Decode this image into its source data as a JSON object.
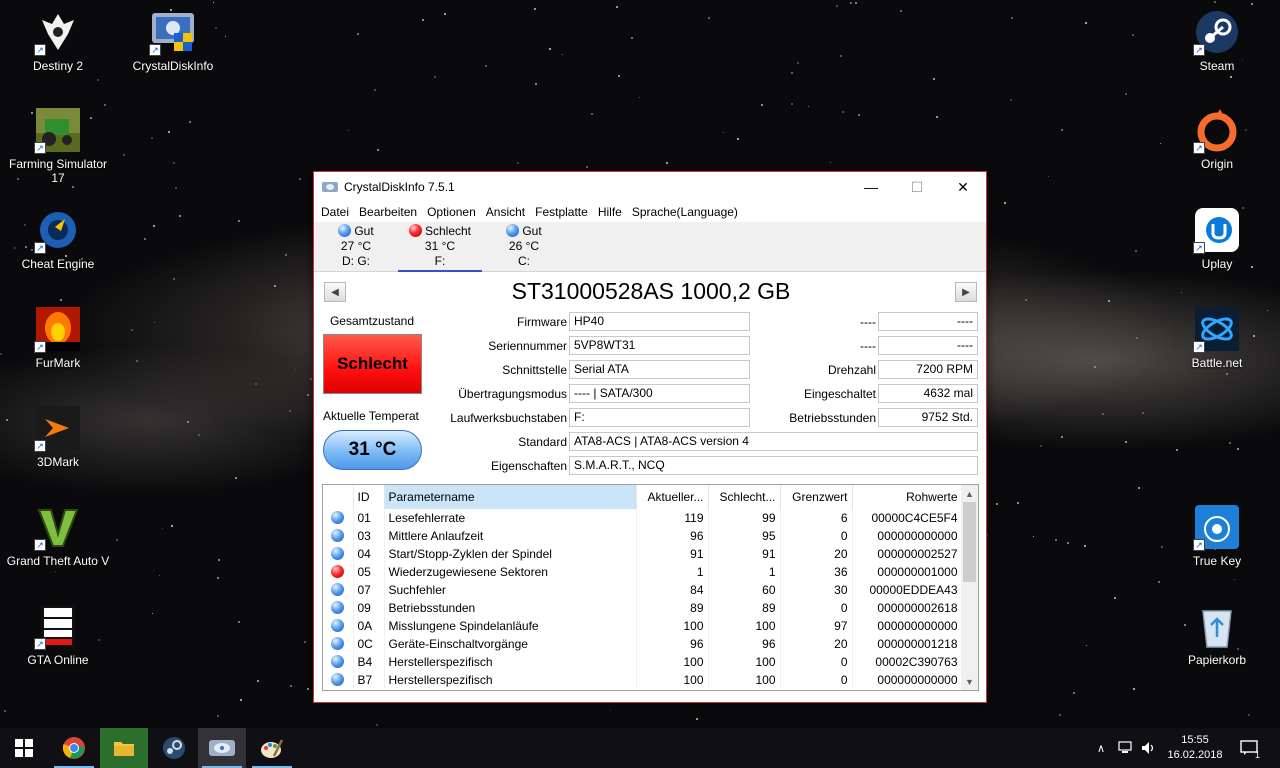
{
  "desktop": {
    "icons_left": [
      {
        "label": "Destiny 2",
        "icon": "destiny-icon"
      },
      {
        "label": "Farming Simulator 17",
        "icon": "farming-simulator-icon"
      },
      {
        "label": "Cheat Engine",
        "icon": "cheat-engine-icon"
      },
      {
        "label": "FurMark",
        "icon": "furmark-icon"
      },
      {
        "label": "3DMark",
        "icon": "3dmark-icon"
      },
      {
        "label": "Grand Theft Auto V",
        "icon": "gta5-icon"
      },
      {
        "label": "GTA Online",
        "icon": "gta-online-icon"
      }
    ],
    "icon_crystal": {
      "label": "CrystalDiskInfo",
      "icon": "crystaldiskinfo-icon"
    },
    "icons_right": [
      {
        "label": "Steam",
        "icon": "steam-icon"
      },
      {
        "label": "Origin",
        "icon": "origin-icon"
      },
      {
        "label": "Uplay",
        "icon": "uplay-icon"
      },
      {
        "label": "Battle.net",
        "icon": "battlenet-icon"
      },
      {
        "label": "True Key",
        "icon": "truekey-icon"
      },
      {
        "label": "Papierkorb",
        "icon": "recycle-bin-icon"
      }
    ]
  },
  "window": {
    "title": "CrystalDiskInfo 7.5.1",
    "controls": {
      "minimize": "—",
      "maximize": "☐",
      "close": "✕"
    },
    "menu": [
      "Datei",
      "Bearbeiten",
      "Optionen",
      "Ansicht",
      "Festplatte",
      "Hilfe",
      "Sprache(Language)"
    ],
    "drives": [
      {
        "status": "Gut",
        "temp": "27 °C",
        "letters": "D: G:",
        "color": "blue"
      },
      {
        "status": "Schlecht",
        "temp": "31 °C",
        "letters": "F:",
        "color": "red"
      },
      {
        "status": "Gut",
        "temp": "26 °C",
        "letters": "C:",
        "color": "blue"
      }
    ],
    "model": "ST31000528AS 1000,2 GB",
    "health_label": "Gesamtzustand",
    "health_value": "Schlecht",
    "temp_label": "Aktuelle Temperat",
    "temp_value": "31 °C",
    "info": {
      "firmware_label": "Firmware",
      "firmware": "HP40",
      "serial_label": "Seriennummer",
      "serial": "5VP8WT31",
      "interface_label": "Schnittstelle",
      "interface": "Serial ATA",
      "transfer_label": "Übertragungsmodus",
      "transfer": "---- | SATA/300",
      "letters_label": "Laufwerksbuchstaben",
      "letters": "F:",
      "standard_label": "Standard",
      "standard": "ATA8-ACS | ATA8-ACS version 4",
      "features_label": "Eigenschaften",
      "features": "S.M.A.R.T., NCQ",
      "r1_label": "----",
      "r1": "----",
      "r2_label": "----",
      "r2": "----",
      "rpm_label": "Drehzahl",
      "rpm": "7200 RPM",
      "poweron_count_label": "Eingeschaltet",
      "poweron_count": "4632 mal",
      "hours_label": "Betriebsstunden",
      "hours": "9752 Std."
    },
    "smart": {
      "headers": [
        "ID",
        "Parametername",
        "Aktueller...",
        "Schlecht...",
        "Grenzwert",
        "Rohwerte"
      ],
      "rows": [
        {
          "status": "blue",
          "id": "01",
          "name": "Lesefehlerrate",
          "current": "119",
          "worst": "99",
          "threshold": "6",
          "raw": "00000C4CE5F4"
        },
        {
          "status": "blue",
          "id": "03",
          "name": "Mittlere Anlaufzeit",
          "current": "96",
          "worst": "95",
          "threshold": "0",
          "raw": "000000000000"
        },
        {
          "status": "blue",
          "id": "04",
          "name": "Start/Stopp-Zyklen der Spindel",
          "current": "91",
          "worst": "91",
          "threshold": "20",
          "raw": "000000002527"
        },
        {
          "status": "red",
          "id": "05",
          "name": "Wiederzugewiesene Sektoren",
          "current": "1",
          "worst": "1",
          "threshold": "36",
          "raw": "000000001000"
        },
        {
          "status": "blue",
          "id": "07",
          "name": "Suchfehler",
          "current": "84",
          "worst": "60",
          "threshold": "30",
          "raw": "00000EDDEA43"
        },
        {
          "status": "blue",
          "id": "09",
          "name": "Betriebsstunden",
          "current": "89",
          "worst": "89",
          "threshold": "0",
          "raw": "000000002618"
        },
        {
          "status": "blue",
          "id": "0A",
          "name": "Misslungene Spindelanläufe",
          "current": "100",
          "worst": "100",
          "threshold": "97",
          "raw": "000000000000"
        },
        {
          "status": "blue",
          "id": "0C",
          "name": "Geräte-Einschaltvorgänge",
          "current": "96",
          "worst": "96",
          "threshold": "20",
          "raw": "000000001218"
        },
        {
          "status": "blue",
          "id": "B4",
          "name": "Herstellerspezifisch",
          "current": "100",
          "worst": "100",
          "threshold": "0",
          "raw": "00002C390763"
        },
        {
          "status": "blue",
          "id": "B7",
          "name": "Herstellerspezifisch",
          "current": "100",
          "worst": "100",
          "threshold": "0",
          "raw": "000000000000"
        }
      ]
    }
  },
  "taskbar": {
    "apps": [
      "windows-start-icon",
      "chrome-icon",
      "file-explorer-icon",
      "steam-taskbar-icon",
      "crystaldiskinfo-taskbar-icon",
      "paint-icon"
    ],
    "time": "15:55",
    "date": "16.02.2018",
    "notifications": "1"
  }
}
